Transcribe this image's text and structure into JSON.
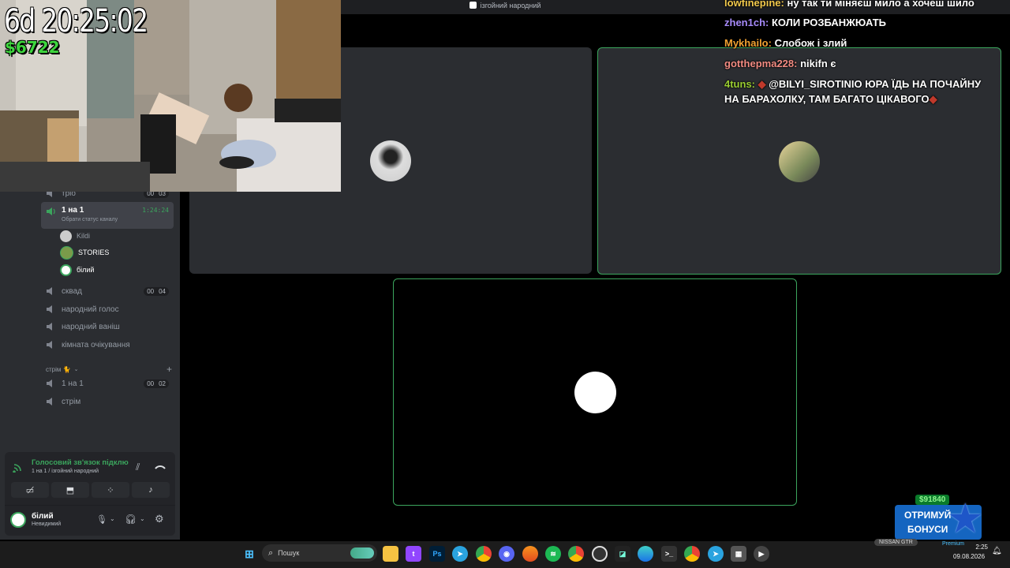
{
  "window": {
    "title": "ізгойний народний"
  },
  "webcam": {
    "timer": "6d 20:25:02",
    "money": "$6722"
  },
  "sidebar": {
    "partial_channel": {
      "label": "тріо",
      "c1": "00",
      "c2": "03"
    },
    "active_channel": {
      "label": "1 на 1",
      "time": "1:24:24",
      "status_hint": "Обрати статус каналу"
    },
    "members": [
      {
        "name": "Kildi"
      },
      {
        "name": "STORIES"
      },
      {
        "name": "білий"
      }
    ],
    "channels": [
      {
        "label": "сквад",
        "c1": "00",
        "c2": "04"
      },
      {
        "label": "народний голос"
      },
      {
        "label": "народний ваніш"
      },
      {
        "label": "кімната очікування"
      }
    ],
    "category": {
      "label": "стрім 🐈"
    },
    "stream_channels": [
      {
        "label": "1 на 1",
        "c1": "00",
        "c2": "02"
      },
      {
        "label": "стрім"
      }
    ]
  },
  "voice_panel": {
    "status": "Голосовий зв'язок підклю",
    "location": "1 на 1 / ізгойний народний"
  },
  "user": {
    "name": "білий",
    "status": "Невидимий"
  },
  "chat": [
    {
      "user": "lowfinepine:",
      "text": "ну так ти міняєш мило а хочеш шило",
      "color": "#f2c94c"
    },
    {
      "user": "zhen1ch:",
      "text": "КОЛИ РОЗБАНЖЮАТЬ",
      "color": "#a78bfa"
    },
    {
      "user": "Mykhailo:",
      "text": "Слобож і злий",
      "color": "#f0a030"
    },
    {
      "user": "gotthepma228:",
      "text": "nikifn є",
      "color": "#f28b82"
    },
    {
      "user": "4tuns:",
      "text": "@BILYI_SIROTINIO ЮРА ЇДЬ НА ПОЧАЙНУ",
      "color": "#9acd32"
    },
    {
      "user": "",
      "text": "НА БАРАХОЛКУ, ТАМ БАГАТО ЦІКАВОГО",
      "color": "#ffffff"
    }
  ],
  "promo": {
    "amount": "$91840",
    "line1": "ОТРИМУЙ",
    "line2": "БОНУСИ"
  },
  "taskbar": {
    "search": "Пошук",
    "tray_label": "NISSAN GTR",
    "premium": "Premium",
    "time": "2:25",
    "date": "09.08.2026"
  },
  "colors": {
    "accent_green": "#3ba55d",
    "sidebar_bg": "#2b2d31",
    "taskbar_bg": "#1c1c1c"
  }
}
